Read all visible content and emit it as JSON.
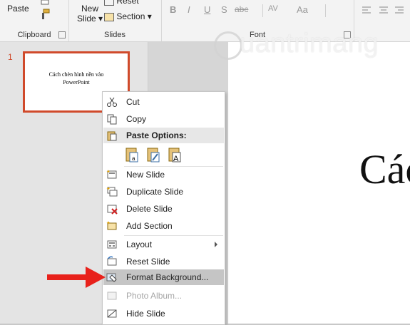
{
  "ribbon": {
    "clipboard": {
      "paste_label": "Paste",
      "group_label": "Clipboard"
    },
    "slides": {
      "new_slide_label_1": "New",
      "new_slide_label_2": "Slide",
      "reset_label": "Reset",
      "section_label": "Section",
      "group_label": "Slides"
    },
    "font": {
      "group_label": "Font",
      "bold": "B",
      "italic": "I",
      "underline": "U",
      "shadow": "S",
      "strike": "abc",
      "spacing": "AV",
      "case": "Aa"
    }
  },
  "thumbnail": {
    "number": "1",
    "text_line1": "Cách chèn hình nền vào",
    "text_line2": "PowerPoint"
  },
  "slide": {
    "title_fragment": "Các"
  },
  "watermark": {
    "text": "uantrimang"
  },
  "menu": {
    "cut": "Cut",
    "copy": "Copy",
    "paste_options": "Paste Options:",
    "new_slide": "New Slide",
    "duplicate_slide": "Duplicate Slide",
    "delete_slide": "Delete Slide",
    "add_section": "Add Section",
    "layout": "Layout",
    "reset_slide": "Reset Slide",
    "format_background": "Format Background...",
    "photo_album": "Photo Album...",
    "hide_slide": "Hide Slide"
  },
  "colors": {
    "accent": "#d04a2b",
    "arrow": "#e8211b",
    "highlight": "#c5c5c5"
  }
}
